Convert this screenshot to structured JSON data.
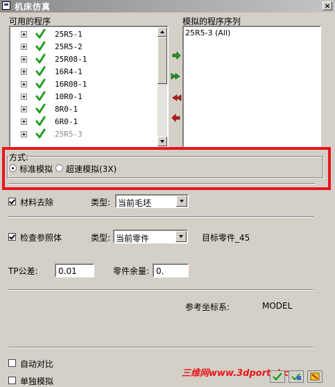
{
  "window": {
    "title": "机床仿真",
    "close_label": "×"
  },
  "available": {
    "label": "可用的程序",
    "items": [
      {
        "label": "25R5-1",
        "enabled": true
      },
      {
        "label": "25R5-2",
        "enabled": true
      },
      {
        "label": "25R08-1",
        "enabled": true
      },
      {
        "label": "16R4-1",
        "enabled": true
      },
      {
        "label": "16R08-1",
        "enabled": true
      },
      {
        "label": "10R0-1",
        "enabled": true
      },
      {
        "label": "8R0-1",
        "enabled": true
      },
      {
        "label": "6R0-1",
        "enabled": true
      },
      {
        "label": "25R5-3",
        "enabled": false
      }
    ]
  },
  "sequence": {
    "label": "模拟的程序序列",
    "items": [
      "25R5-3 (All)"
    ]
  },
  "mode": {
    "label": "方式:",
    "options": [
      {
        "label": "标准模拟",
        "selected": true
      },
      {
        "label": "超速模拟(3X)",
        "selected": false
      }
    ]
  },
  "material_removal": {
    "label": "材料去除",
    "checked": true,
    "type_label": "类型:",
    "type_value": "当前毛坯"
  },
  "check_reference": {
    "label": "检查参照体",
    "checked": true,
    "type_label": "类型:",
    "type_value": "当前零件",
    "target_text": "目标零件_45"
  },
  "tp_tolerance": {
    "label": "TP公差:",
    "value": "0.01"
  },
  "part_allowance": {
    "label": "零件余量:",
    "value": "0."
  },
  "ref_coord": {
    "label": "参考坐标系:",
    "value": "MODEL"
  },
  "auto_compare": {
    "label": "自动对比",
    "checked": false
  },
  "single_step": {
    "label": "单独模拟",
    "checked": false
  },
  "watermark": "三维网www.3dportal.cn",
  "colors": {
    "highlight": "#e8151b",
    "check_green": "#1f9d1f",
    "arrow_red": "#c81818"
  },
  "icons": {
    "add": "green-arrow-right-icon",
    "add_all": "green-double-arrow-right-icon",
    "remove_all": "red-double-arrow-left-icon",
    "remove": "red-arrow-left-icon"
  }
}
